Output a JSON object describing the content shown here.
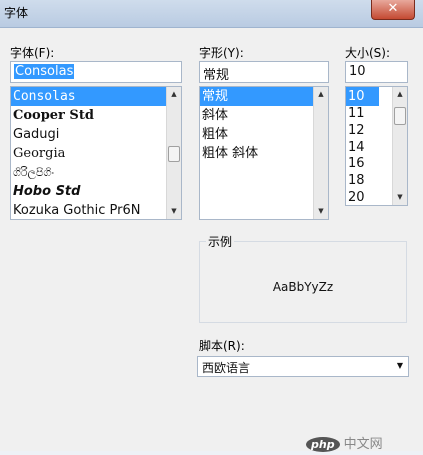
{
  "window": {
    "title": "字体",
    "close_symbol": "✕"
  },
  "font": {
    "label": "字体(F):",
    "value": "Consolas",
    "items": [
      "Consolas",
      "Cooper Std",
      "Gadugi",
      "Georgia",
      "ගිරිලපිගිං",
      "Hobo Std",
      "Kozuka Gothic Pr6N"
    ],
    "selected": "Consolas"
  },
  "style": {
    "label": "字形(Y):",
    "value": "常规",
    "items": [
      "常规",
      "斜体",
      "粗体",
      "粗体 斜体"
    ],
    "selected": "常规"
  },
  "size": {
    "label": "大小(S):",
    "value": "10",
    "items": [
      "10",
      "11",
      "12",
      "14",
      "16",
      "18",
      "20"
    ],
    "selected": "10"
  },
  "preview": {
    "label": "示例",
    "text": "AaBbYyZz"
  },
  "script": {
    "label": "脚本(R):",
    "value": "西欧语言"
  },
  "watermark": {
    "logo": "php",
    "text": "中文网"
  },
  "icons": {
    "up": "up-arrow-icon",
    "down": "down-arrow-icon",
    "dropdown": "chevron-down-icon"
  }
}
